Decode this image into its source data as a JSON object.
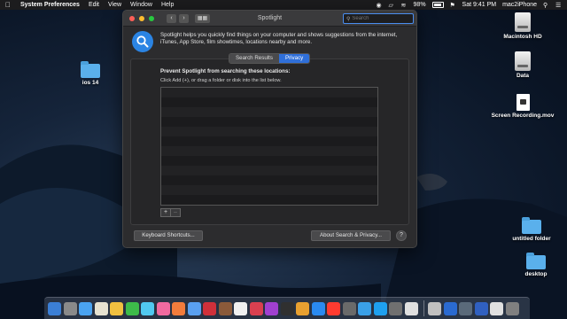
{
  "menubar": {
    "app_name": "System Preferences",
    "items": [
      "Edit",
      "View",
      "Window",
      "Help"
    ],
    "battery": "98%",
    "clock": "Sat 9:41 PM",
    "user": "mac2iPhone"
  },
  "window": {
    "title": "Spotlight",
    "search_placeholder": "Search",
    "description": "Spotlight helps you quickly find things on your computer and shows suggestions from the internet, iTunes, App Store, film showtimes, locations nearby and more.",
    "tabs": [
      "Search Results",
      "Privacy"
    ],
    "active_tab": "Privacy",
    "prevent_heading": "Prevent Spotlight from searching these locations:",
    "prevent_hint": "Click Add (+), or drag a folder or disk into the list below.",
    "add_label": "+",
    "remove_label": "–",
    "keyboard_shortcuts": "Keyboard Shortcuts...",
    "about_search": "About Search & Privacy...",
    "help": "?"
  },
  "desktop": {
    "icons": [
      {
        "label": "Macintosh HD",
        "kind": "drive"
      },
      {
        "label": "Data",
        "kind": "drive"
      },
      {
        "label": "Screen Recording.mov",
        "kind": "doc"
      },
      {
        "label": "untitled folder",
        "kind": "folder"
      },
      {
        "label": "desktop",
        "kind": "folder"
      },
      {
        "label": "ios 14",
        "kind": "folder"
      }
    ]
  },
  "dock": {
    "colors": [
      "#3b7fd6",
      "#8a8a8a",
      "#4aa3f0",
      "#e7e2d0",
      "#f0c040",
      "#3dbb4a",
      "#50c8f0",
      "#f06aa0",
      "#f27c3c",
      "#5aa0f0",
      "#d0303a",
      "#8a5a3a",
      "#f0f0f0",
      "#d94050",
      "#a040d0",
      "#303030",
      "#e8a030",
      "#2a8af0",
      "#ff3b30",
      "#6a6a6a",
      "#3aa0e8",
      "#1ea0f0",
      "#707070",
      "#e0e0e0",
      "#c0c0c0",
      "#2a6ad0",
      "#5a6a7a",
      "#3060c0",
      "#e0e0e0",
      "#808080"
    ]
  }
}
